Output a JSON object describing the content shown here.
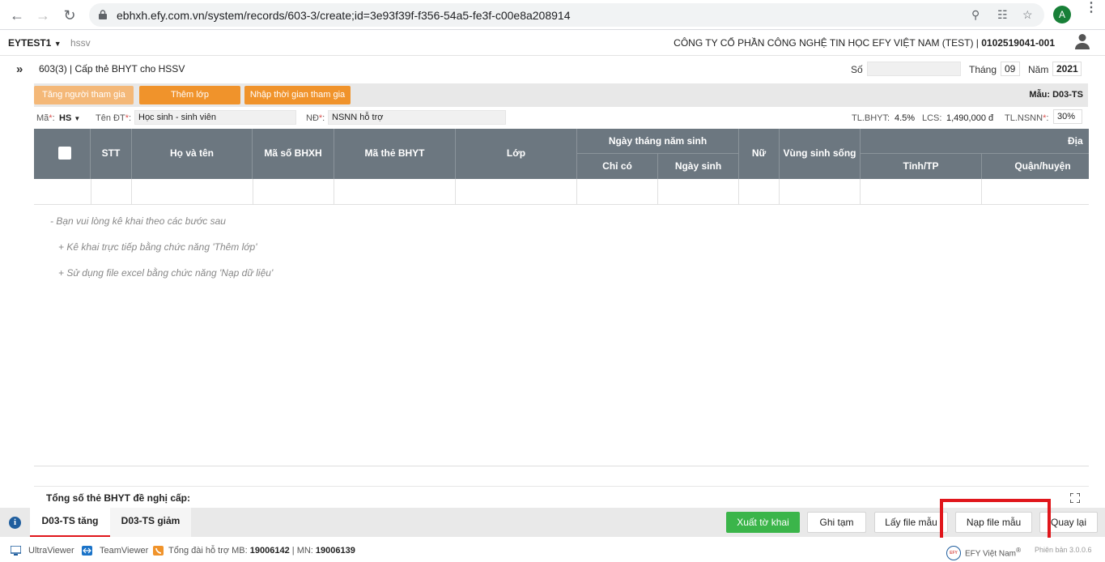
{
  "browser": {
    "url": "ebhxh.efy.com.vn/system/records/603-3/create;id=3e93f39f-f356-54a5-fe3f-c00e8a208914",
    "avatar_letter": "A"
  },
  "header": {
    "tenant": "EYTEST1",
    "tenant_sub": "hssv",
    "company_name": "CÔNG TY CỔ PHẦN CÔNG NGHỆ TIN HỌC EFY VIỆT NAM (TEST) |",
    "tax_code": "0102519041-001"
  },
  "record": {
    "title": "603(3) | Cấp thẻ BHYT cho HSSV",
    "so_label": "Số",
    "so_value": "",
    "thang_label": "Tháng",
    "thang_value": "09",
    "nam_label": "Năm",
    "nam_value": "2021"
  },
  "toolbar": {
    "btn_increase": "Tăng người tham gia",
    "btn_add_class": "Thêm lớp",
    "btn_enter_time": "Nhập thời gian tham gia",
    "template": "Mẫu: D03-TS"
  },
  "params": {
    "ma_label": "Mã",
    "ma_value": "HS",
    "ten_dt_label": "Tên ĐT",
    "ten_dt_value": "Học sinh - sinh viên",
    "nd_label": "NĐ",
    "nd_value": "NSNN hỗ trợ",
    "tl_bhyt_label": "TL.BHYT:",
    "tl_bhyt_value": "4.5%",
    "lcs_label": "LCS:",
    "lcs_value": "1,490,000 đ",
    "tl_nsnn_label": "TL.NSNN",
    "tl_nsnn_value": "30%"
  },
  "grid": {
    "columns": {
      "stt": "STT",
      "ho_ten": "Họ và tên",
      "ma_bhxh": "Mã số BHXH",
      "ma_the": "Mã thẻ BHYT",
      "lop": "Lớp",
      "ngay_sinh_group": "Ngày tháng năm sinh",
      "chi_co": "Chỉ có",
      "ngay_sinh": "Ngày sinh",
      "nu": "Nữ",
      "vung_sinh_song": "Vùng sinh sống",
      "dia_chi_group": "Địa",
      "tinh_tp": "Tỉnh/TP",
      "quan_huyen": "Quận/huyện"
    }
  },
  "hints": {
    "line1": "- Bạn vui lòng kê khai theo các bước sau",
    "line2": "+ Kê khai trực tiếp bằng chức năng 'Thêm lớp'",
    "line3": "+ Sử dụng file excel bằng chức năng 'Nạp dữ liệu'"
  },
  "summary": "Tổng số thẻ BHYT đề nghị cấp:",
  "tabs": {
    "tab1": "D03-TS tăng",
    "tab2": "D03-TS giảm"
  },
  "actions": {
    "export": "Xuất tờ khai",
    "save_draft": "Ghi tạm",
    "get_template": "Lấy file mẫu",
    "load_template": "Nạp file mẫu",
    "back": "Quay lại"
  },
  "colors": {
    "orange": "#f0932b",
    "orange_light": "#f4b878",
    "grid_header": "#6c7780",
    "green": "#3bb54a",
    "highlight_red": "#e0161b"
  },
  "taskbar": {
    "ultraviewer": "UltraViewer",
    "teamviewer": "TeamViewer",
    "hotline_label": "Tổng đài hỗ trợ MB:",
    "hotline_mb": "19006142",
    "hotline_sep": "| MN:",
    "hotline_mn": "19006139",
    "efy_brand": "EFY Việt Nam",
    "version": "Phiên bản 3.0.0.6"
  }
}
